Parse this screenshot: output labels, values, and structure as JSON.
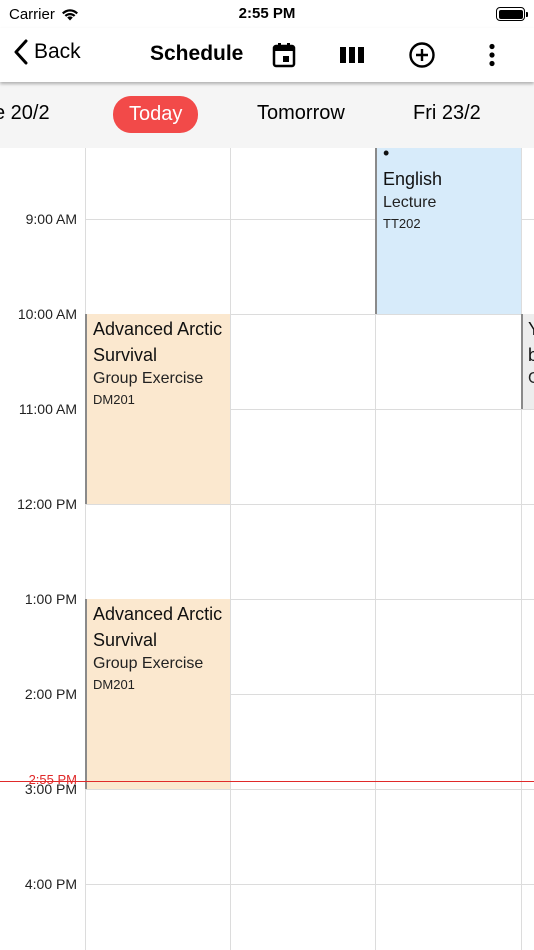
{
  "status_bar": {
    "carrier": "Carrier",
    "time": "2:55 PM"
  },
  "nav": {
    "back_label": "Back",
    "title": "Schedule"
  },
  "days": {
    "prev": "e 20/2",
    "today": "Today",
    "tomorrow": "Tomorrow",
    "next": "Fri 23/2"
  },
  "hours": [
    "9:00 AM",
    "10:00 AM",
    "11:00 AM",
    "12:00 PM",
    "1:00 PM",
    "2:00 PM",
    "3:00 PM",
    "4:00 PM"
  ],
  "now_label": "2:55 PM",
  "events": {
    "english": {
      "title_top": "English",
      "type": "Lecture",
      "room": "TT202"
    },
    "arctic_morning": {
      "title": "Advanced Arctic Survival",
      "type": "Group Exercise",
      "room": "DM201"
    },
    "arctic_afternoon": {
      "title": "Advanced Arctic Survival",
      "type": "Group Exercise",
      "room": "DM201"
    },
    "edge_event": {
      "line1": "Y",
      "line2": "b",
      "line3": "G"
    }
  },
  "colors": {
    "today_pill": "#f24a49",
    "event_orange": "#fbe8cf",
    "event_blue": "#d7ebfa",
    "event_gray": "#ededed",
    "now_line": "#e02a2a"
  },
  "icons": [
    "chevron-left-icon",
    "calendar-icon",
    "columns-icon",
    "plus-circle-icon",
    "more-vertical-icon",
    "wifi-icon",
    "battery-icon"
  ]
}
